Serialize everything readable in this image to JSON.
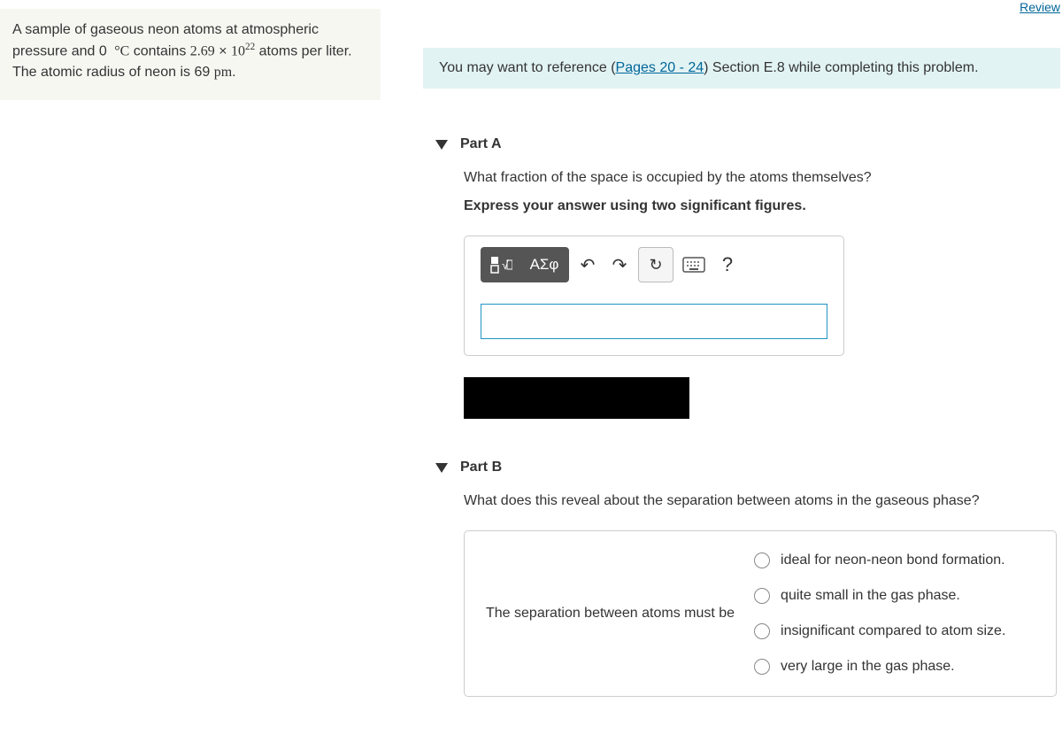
{
  "review_link": "Review",
  "problem_text_parts": {
    "p1": "A sample of gaseous neon atoms at atmospheric pressure and 0",
    "degC": "°C",
    "p2": " contains ",
    "coef": "2.69",
    "times": " × ",
    "base": "10",
    "exp": "22",
    "p3": " atoms per liter. The atomic radius of neon is 69 ",
    "unit": "pm",
    "p4": "."
  },
  "hint": {
    "prefix": "You may want to reference (",
    "link": "Pages 20 - 24",
    "suffix": ") Section E.8 while completing this problem."
  },
  "partA": {
    "title": "Part A",
    "question": "What fraction of the space is occupied by the atoms themselves?",
    "instruction": "Express your answer using two significant figures.",
    "toolbar": {
      "template": "template",
      "math": "√",
      "greek": "ΑΣφ",
      "undo": "↶",
      "redo": "↷",
      "reset": "↻",
      "keyboard": "⌨",
      "help": "?"
    }
  },
  "partB": {
    "title": "Part B",
    "question": "What does this reveal about the separation between atoms in the gaseous phase?",
    "stem": "The separation between atoms must be",
    "options": [
      "ideal for neon-neon bond formation.",
      "quite small in the gas phase.",
      "insignificant compared to atom size.",
      "very large in the gas phase."
    ]
  }
}
